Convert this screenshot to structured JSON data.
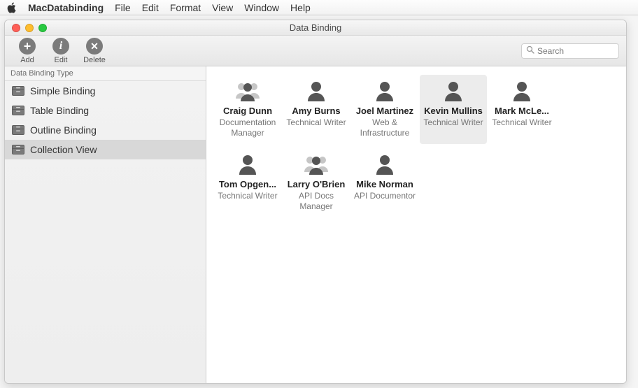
{
  "menubar": {
    "app_name": "MacDatabinding",
    "items": [
      "File",
      "Edit",
      "Format",
      "View",
      "Window",
      "Help"
    ]
  },
  "window": {
    "title": "Data Binding"
  },
  "toolbar": {
    "buttons": {
      "add": "Add",
      "edit": "Edit",
      "delete": "Delete"
    },
    "search_placeholder": "Search"
  },
  "sidebar": {
    "header": "Data Binding Type",
    "items": [
      {
        "label": "Simple Binding",
        "selected": false
      },
      {
        "label": "Table Binding",
        "selected": false
      },
      {
        "label": "Outline Binding",
        "selected": false
      },
      {
        "label": "Collection View",
        "selected": true
      }
    ]
  },
  "collection": {
    "people": [
      {
        "name": "Craig Dunn",
        "role": "Documentation Manager",
        "manager": true,
        "selected": false
      },
      {
        "name": "Amy Burns",
        "role": "Technical Writer",
        "manager": false,
        "selected": false
      },
      {
        "name": "Joel Martinez",
        "role": "Web & Infrastructure",
        "manager": false,
        "selected": false
      },
      {
        "name": "Kevin Mullins",
        "role": "Technical Writer",
        "manager": false,
        "selected": true
      },
      {
        "name": "Mark McLe...",
        "role": "Technical Writer",
        "manager": false,
        "selected": false
      },
      {
        "name": "Tom Opgen...",
        "role": "Technical Writer",
        "manager": false,
        "selected": false
      },
      {
        "name": "Larry O'Brien",
        "role": "API Docs Manager",
        "manager": true,
        "selected": false
      },
      {
        "name": "Mike Norman",
        "role": "API Documentor",
        "manager": false,
        "selected": false
      }
    ]
  }
}
